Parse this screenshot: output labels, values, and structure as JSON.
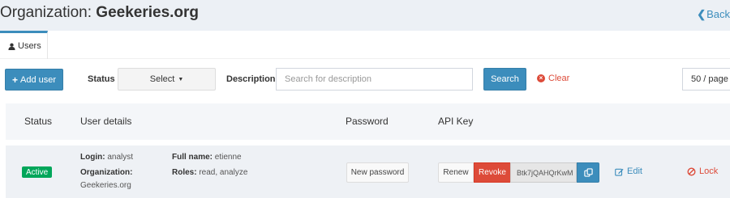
{
  "header": {
    "title_prefix": "Organization: ",
    "title_org": "Geekeries.org",
    "back_label": "Back"
  },
  "tabs": [
    {
      "label": "Users",
      "icon": "user-icon"
    }
  ],
  "toolbar": {
    "add_user_label": "Add user",
    "status_label": "Status",
    "status_select_value": "Select",
    "description_label": "Description",
    "description_placeholder": "Search for description",
    "search_label": "Search",
    "clear_label": "Clear",
    "page_size_value": "50 / page"
  },
  "table": {
    "columns": [
      "Status",
      "User details",
      "Password",
      "API Key"
    ],
    "rows": [
      {
        "status": "Active",
        "login_label": "Login:",
        "login_value": "analyst",
        "org_label": "Organization:",
        "org_value": "Geekeries.org",
        "fullname_label": "Full name:",
        "fullname_value": "etienne",
        "roles_label": "Roles:",
        "roles_value": "read, analyze",
        "new_password_label": "New password",
        "renew_label": "Renew",
        "revoke_label": "Revoke",
        "api_key_value": "Btk7jQAHQrKwM",
        "edit_label": "Edit",
        "lock_label": "Lock"
      }
    ]
  },
  "colors": {
    "primary": "#3c8dbc",
    "danger": "#dd4b39",
    "success": "#00a65a",
    "header_bg": "#ecf0f5"
  }
}
